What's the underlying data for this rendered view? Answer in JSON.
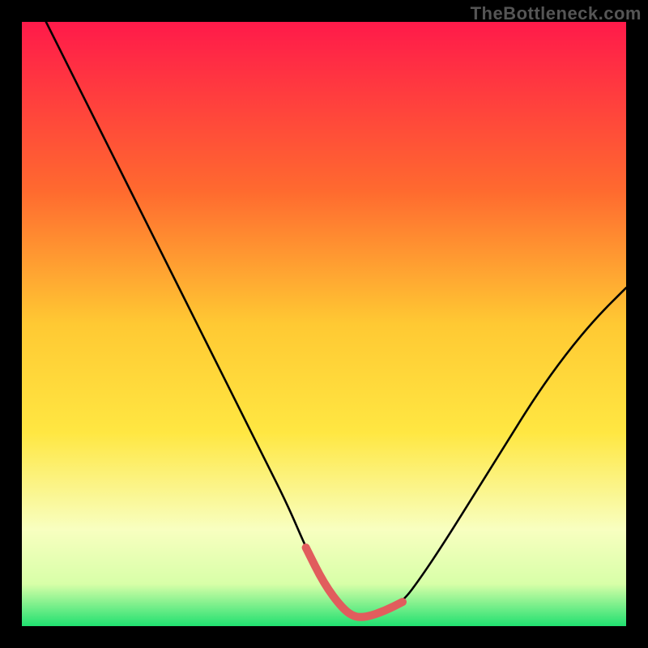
{
  "watermark": "TheBottleneck.com",
  "colors": {
    "bg_black": "#000000",
    "curve": "#000000",
    "highlight": "#e15d5d",
    "grad_top": "#ff1a4a",
    "grad_mid_upper": "#ff8a2a",
    "grad_mid": "#ffe742",
    "grad_lower": "#f6ffb0",
    "grad_bottom": "#20e070"
  },
  "chart_data": {
    "type": "line",
    "title": "",
    "xlabel": "",
    "ylabel": "",
    "xlim": [
      0,
      100
    ],
    "ylim": [
      0,
      100
    ],
    "series": [
      {
        "name": "bottleneck-curve",
        "x": [
          4,
          8,
          12,
          16,
          20,
          24,
          28,
          32,
          36,
          40,
          44,
          47,
          50,
          53,
          55,
          57,
          60,
          63,
          66,
          70,
          75,
          80,
          85,
          90,
          95,
          100
        ],
        "y": [
          100,
          92,
          84,
          76,
          68,
          60,
          52,
          44,
          36,
          28,
          20,
          13,
          7,
          3,
          1.5,
          1.5,
          2.5,
          4,
          8,
          14,
          22,
          30,
          38,
          45,
          51,
          56
        ]
      }
    ],
    "highlight_range_x": [
      47,
      63
    ],
    "annotations": []
  }
}
